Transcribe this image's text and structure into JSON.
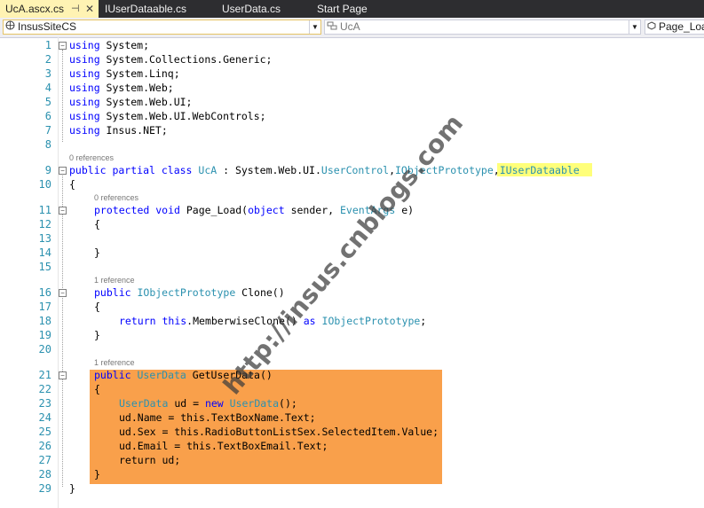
{
  "tabs": [
    {
      "label": "UcA.ascx.cs",
      "active": true
    },
    {
      "label": "IUserDataable.cs",
      "active": false
    },
    {
      "label": "UserData.cs",
      "active": false
    },
    {
      "label": "Start Page",
      "active": false
    }
  ],
  "nav": {
    "project": "InsusSiteCS",
    "class": "UcA",
    "member": "Page_Load"
  },
  "refs": {
    "r0": "0 references",
    "r1": "0 references",
    "r2": "1 reference",
    "r3": "1 reference"
  },
  "lines": [
    {
      "n": "1"
    },
    {
      "n": "2"
    },
    {
      "n": "3"
    },
    {
      "n": "4"
    },
    {
      "n": "5"
    },
    {
      "n": "6"
    },
    {
      "n": "7"
    },
    {
      "n": "8"
    },
    {
      "n": "9"
    },
    {
      "n": "10"
    },
    {
      "n": "11"
    },
    {
      "n": "12"
    },
    {
      "n": "13"
    },
    {
      "n": "14"
    },
    {
      "n": "15"
    },
    {
      "n": "16"
    },
    {
      "n": "17"
    },
    {
      "n": "18"
    },
    {
      "n": "19"
    },
    {
      "n": "20"
    },
    {
      "n": "21"
    },
    {
      "n": "22"
    },
    {
      "n": "23"
    },
    {
      "n": "24"
    },
    {
      "n": "25"
    },
    {
      "n": "26"
    },
    {
      "n": "27"
    },
    {
      "n": "28"
    },
    {
      "n": "29"
    }
  ],
  "code": {
    "kw_using": "using",
    "l1": " System;",
    "l2": " System.Collections.Generic;",
    "l3": " System.Linq;",
    "l4": " System.Web;",
    "l5": " System.Web.UI;",
    "l6": " System.Web.UI.WebControls;",
    "l7": " Insus.NET;",
    "l9_kw": "public partial class",
    "l9_cls": " UcA",
    "l9_mid": " : System.Web.UI.",
    "l9_uc": "UserControl",
    "l9_c1": ",",
    "l9_iop": "IObjectPrototype",
    "l9_c2": ",",
    "l9_iud": "IUserDataable",
    "brace_open": "{",
    "brace_close": "}",
    "l11_kw": "protected void",
    "l11_a": " Page_Load(",
    "l11_obj": "object",
    "l11_b": " sender, ",
    "l11_ea": "EventArgs",
    "l11_c": " e)",
    "l16_kw": "public",
    "l16_ty": " IObjectPrototype",
    "l16_rest": " Clone()",
    "l18_ret": "return",
    "l18_this": " this",
    "l18_mid": ".MemberwiseClone() ",
    "l18_as": "as",
    "l18_ty": " IObjectPrototype",
    "l18_end": ";",
    "l21_kw": "public",
    "l21_ty": " UserData",
    "l21_rest": " GetUserData()",
    "l23_ty": "UserData",
    "l23_a": " ud = ",
    "l23_new": "new",
    "l23_ty2": " UserData",
    "l23_b": "();",
    "l24": "ud.Name = this.TextBoxName.Text;",
    "l25": "ud.Sex = this.RadioButtonListSex.SelectedItem.Value;",
    "l26": "ud.Email = this.TextBoxEmail.Text;",
    "l27": "return ud;"
  },
  "watermark": "http://insus.cnblogs.com"
}
